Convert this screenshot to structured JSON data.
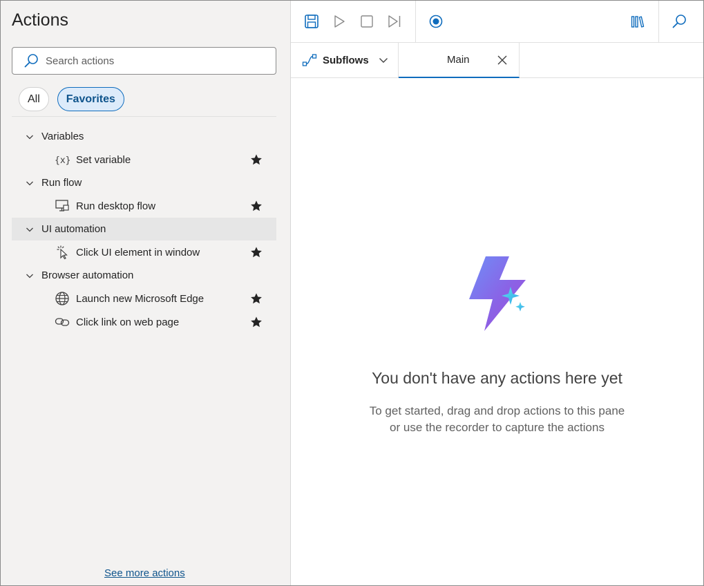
{
  "left_pane": {
    "title": "Actions",
    "search": {
      "placeholder": "Search actions"
    },
    "filters": [
      {
        "label": "All",
        "active": false
      },
      {
        "label": "Favorites",
        "active": true
      }
    ],
    "groups": [
      {
        "label": "Variables",
        "expanded": true,
        "items": [
          {
            "label": "Set variable",
            "icon": "variable-icon",
            "favorite": true
          }
        ]
      },
      {
        "label": "Run flow",
        "expanded": true,
        "items": [
          {
            "label": "Run desktop flow",
            "icon": "desktop-flow-icon",
            "favorite": true
          }
        ]
      },
      {
        "label": "UI automation",
        "expanded": true,
        "highlighted": true,
        "items": [
          {
            "label": "Click UI element in window",
            "icon": "click-cursor-icon",
            "favorite": true
          }
        ]
      },
      {
        "label": "Browser automation",
        "expanded": true,
        "items": [
          {
            "label": "Launch new Microsoft Edge",
            "icon": "globe-icon",
            "favorite": true
          },
          {
            "label": "Click link on web page",
            "icon": "link-icon",
            "favorite": true
          }
        ]
      }
    ],
    "see_more": "See more actions"
  },
  "toolbar": {
    "buttons": [
      "save-icon",
      "run-icon",
      "stop-icon",
      "step-icon",
      "record-icon",
      "library-icon",
      "search-icon"
    ]
  },
  "tabs": {
    "subflows_label": "Subflows",
    "main_label": "Main"
  },
  "empty_state": {
    "title": "You don't have any actions here yet",
    "line1": "To get started, drag and drop actions to this pane",
    "line2": "or use the recorder to capture the actions"
  },
  "colors": {
    "accent": "#0f6cbd",
    "pane_bg": "#f3f2f1",
    "link": "#0f548c"
  }
}
